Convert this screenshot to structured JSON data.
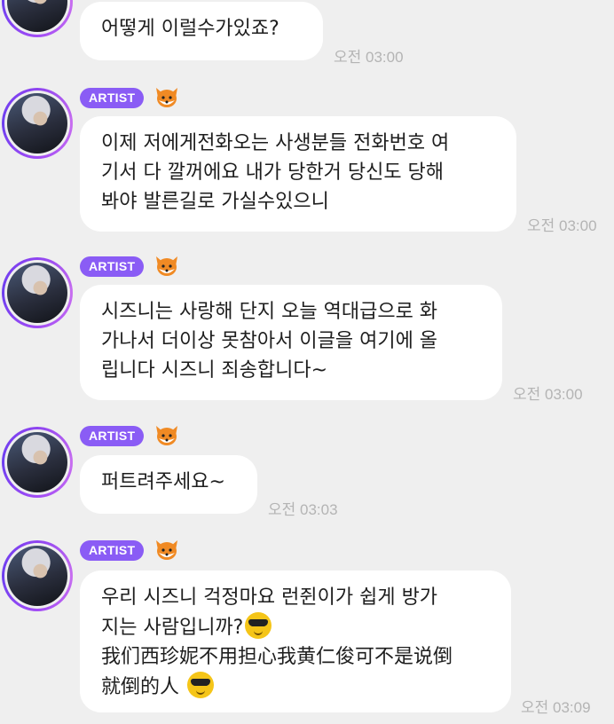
{
  "artist_badge": "ARTIST",
  "icons": {
    "avatar": "avatar-photo",
    "fox": "fox-icon",
    "emoji": "sunglasses-emoji"
  },
  "colors": {
    "badge": "#8a5cf5",
    "avatar_ring": "#8e44f0",
    "background": "#efefef",
    "bubble": "#ffffff",
    "timestamp": "#b4b4b4"
  },
  "messages": [
    {
      "text": "어떻게 이럴수가있죠?",
      "time": "오전 03:00"
    },
    {
      "text": "이제 저에게전화오는 사생분들 전화번호 여\n기서 다 깔꺼에요 내가 당한거 당신도 당해\n봐야 발른길로 가실수있으니",
      "time": "오전 03:00"
    },
    {
      "text": "시즈니는 사랑해 단지 오늘 역대급으로 화\n가나서 더이상 못참아서 이글을 여기에 올\n립니다 시즈니 죄송합니다~",
      "time": "오전 03:00"
    },
    {
      "text": "퍼트려주세요~",
      "time": "오전 03:03"
    },
    {
      "line1": "우리 시즈니 걱정마요 런쥔이가 쉽게 방가",
      "line2": "지는 사람입니까?",
      "line3": "我们西珍妮不用担心我黄仁俊可不是说倒",
      "line4": "就倒的人",
      "time": "오전 03:09"
    }
  ]
}
